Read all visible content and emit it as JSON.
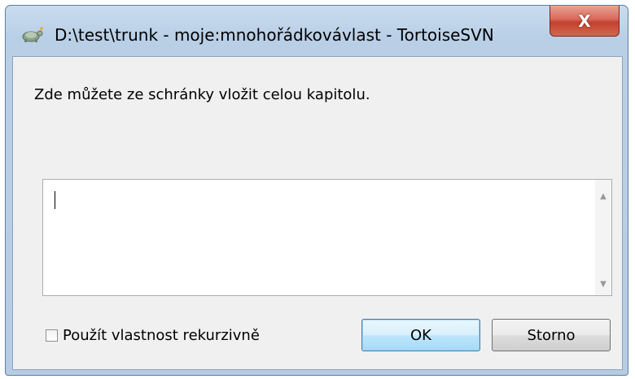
{
  "window": {
    "title": "D:\\test\\trunk - moje:mnohořádkovávlast - TortoiseSVN",
    "app_icon": "tortoise-icon",
    "close_glyph": "X"
  },
  "dialog": {
    "prompt": "Zde můžete ze schránky vložit celou kapitolu.",
    "textarea_value": "",
    "recursive_checkbox": {
      "label": "Použít vlastnost rekurzivně",
      "checked": false
    },
    "buttons": {
      "ok": "OK",
      "cancel": "Storno"
    }
  },
  "colors": {
    "titlebar": "#b9cfe6",
    "client_bg": "#f0f0f0",
    "close_button": "#c2402e",
    "default_button_border": "#3c7fb1"
  }
}
